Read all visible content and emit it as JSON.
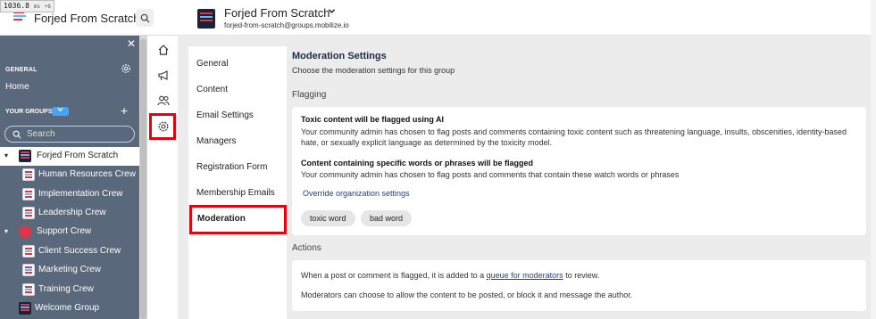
{
  "perf": {
    "value": "1036.8",
    "unit": "ms",
    "extra": "+6"
  },
  "app": {
    "title": "Forjed From Scratch"
  },
  "group_header": {
    "name": "Forjed From Scratch",
    "email": "forjed-from-scratch@groups.mobilize.io"
  },
  "sidebar": {
    "general_heading": "GENERAL",
    "home": "Home",
    "your_groups": "YOUR GROUPS",
    "search_placeholder": "Search",
    "groups": [
      {
        "label": "Forjed From Scratch",
        "selected": true
      },
      {
        "label": "Human Resources Crew"
      },
      {
        "label": "Implementation Crew"
      },
      {
        "label": "Leadership Crew"
      },
      {
        "label": "Support Crew"
      },
      {
        "label": "Client Success Crew"
      },
      {
        "label": "Marketing Crew"
      },
      {
        "label": "Training Crew"
      },
      {
        "label": "Welcome Group"
      }
    ]
  },
  "rail_icons": [
    "home-icon",
    "megaphone-icon",
    "people-icon",
    "gear-icon"
  ],
  "subnav": {
    "items": [
      "General",
      "Content",
      "Email Settings",
      "Managers",
      "Registration Form",
      "Membership Emails",
      "Moderation"
    ]
  },
  "moderation": {
    "title": "Moderation Settings",
    "subtitle": "Choose the moderation settings for this group",
    "flagging_heading": "Flagging",
    "toxic_heading": "Toxic content will be flagged using AI",
    "toxic_text": "Your community admin has chosen to flag posts and comments containing toxic content such as threatening language, insults, obscenities, identity-based hate, or sexually explicit language as determined by the toxicity model.",
    "words_heading": "Content containing specific words or phrases will be flagged",
    "words_text": "Your community admin has chosen to flag posts and comments that contain these watch words or phrases",
    "override_link": "Override organization settings",
    "watch_words": [
      "toxic word",
      "bad word"
    ],
    "actions_heading": "Actions",
    "actions_line1_pre": "When a post or comment is flagged, it is added to a ",
    "actions_line1_link": "queue for moderators",
    "actions_line1_post": " to review.",
    "actions_line2": "Moderators can choose to allow the content to be posted, or block it and message the author."
  },
  "colors": {
    "sidebar": "#59687a",
    "highlight": "#e8000d",
    "link": "#1f3f8c",
    "main_bg": "#ececec"
  }
}
